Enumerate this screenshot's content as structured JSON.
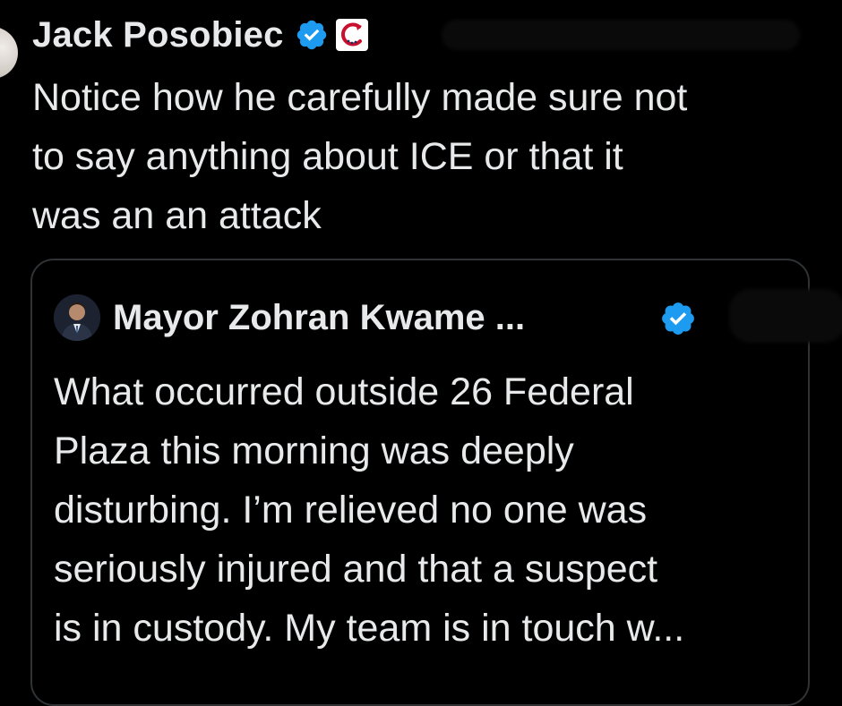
{
  "tweet": {
    "author_name": "Jack Posobiec",
    "text": "Notice how he carefully made sure not\nto say anything about ICE or that it\nwas an an attack",
    "icons": {
      "verified": "verified-badge-icon",
      "affiliate": "affiliate-badge-icon"
    }
  },
  "quote": {
    "author_name": "Mayor Zohran Kwame ...",
    "text": "What occurred outside 26 Federal\nPlaza this morning was deeply\ndisturbing. I’m relieved no one was\nseriously injured and that a suspect\nis in custody. My team is in touch w...",
    "icons": {
      "verified": "verified-badge-icon"
    }
  },
  "colors": {
    "background": "#000000",
    "text": "#e7e9ea",
    "verified_blue": "#1d9bf0",
    "card_border": "#2f3336",
    "affiliate_red": "#c8102e",
    "affiliate_navy": "#1f2d5c"
  }
}
